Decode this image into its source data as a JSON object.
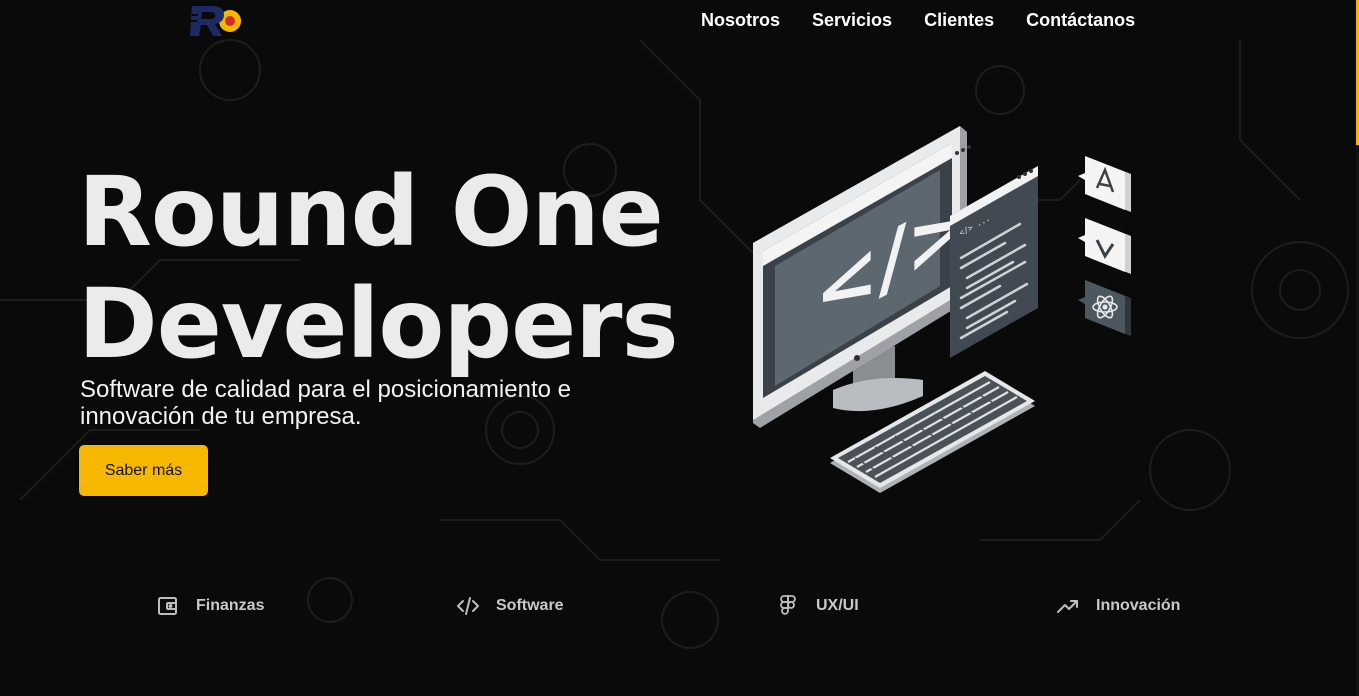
{
  "brand": {
    "logo_text": "RO"
  },
  "nav": {
    "items": [
      {
        "label": "Nosotros"
      },
      {
        "label": "Servicios"
      },
      {
        "label": "Clientes"
      },
      {
        "label": "Contáctanos"
      }
    ]
  },
  "hero": {
    "title_line1": "Round One",
    "title_line2": "Developers",
    "subtitle": "Software de calidad para el posicionamiento e innovación de tu empresa.",
    "cta_label": "Saber más"
  },
  "illustration": {
    "code_symbol": "</>",
    "code_window_text": "</> ...",
    "badges": [
      "A",
      "V"
    ],
    "badge_icons": [
      "angular-icon",
      "vue-icon",
      "react-icon"
    ]
  },
  "features": [
    {
      "label": "Finanzas",
      "icon": "wallet-icon"
    },
    {
      "label": "Software",
      "icon": "code-icon"
    },
    {
      "label": "UX/UI",
      "icon": "figma-icon"
    },
    {
      "label": "Innovación",
      "icon": "trending-up-icon"
    }
  ],
  "colors": {
    "accent": "#f5b700",
    "background": "#0a0a0a",
    "text": "#ebebeb",
    "logo_blue": "#1e2a63"
  }
}
